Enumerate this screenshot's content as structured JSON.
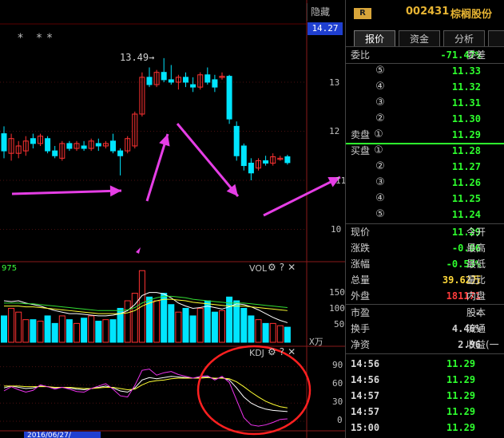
{
  "window": {
    "hide_label": "隐藏>>"
  },
  "kline": {
    "current_price_tag": "14.27",
    "stars": "* **",
    "peak_label": "13.49→",
    "y_ticks": [
      "13",
      "12",
      "11",
      "10"
    ],
    "up_color": "#ff3232",
    "down_color": "#00e5ff",
    "candles": [
      {
        "o": 11.95,
        "h": 12.1,
        "l": 11.45,
        "c": 11.6
      },
      {
        "o": 11.55,
        "h": 11.95,
        "l": 11.4,
        "c": 11.85
      },
      {
        "o": 11.55,
        "h": 11.8,
        "l": 11.45,
        "c": 11.7
      },
      {
        "o": 11.6,
        "h": 11.9,
        "l": 11.5,
        "c": 11.8
      },
      {
        "o": 11.85,
        "h": 11.95,
        "l": 11.65,
        "c": 11.75
      },
      {
        "o": 11.75,
        "h": 11.95,
        "l": 11.7,
        "c": 11.9
      },
      {
        "o": 11.85,
        "h": 11.9,
        "l": 11.55,
        "c": 11.6
      },
      {
        "o": 11.6,
        "h": 11.7,
        "l": 11.45,
        "c": 11.5
      },
      {
        "o": 11.45,
        "h": 11.8,
        "l": 11.4,
        "c": 11.75
      },
      {
        "o": 11.75,
        "h": 11.8,
        "l": 11.6,
        "c": 11.65
      },
      {
        "o": 11.65,
        "h": 11.8,
        "l": 11.6,
        "c": 11.75
      },
      {
        "o": 11.7,
        "h": 11.8,
        "l": 11.6,
        "c": 11.65
      },
      {
        "o": 11.65,
        "h": 11.85,
        "l": 11.6,
        "c": 11.8
      },
      {
        "o": 11.75,
        "h": 11.85,
        "l": 11.6,
        "c": 11.7
      },
      {
        "o": 11.7,
        "h": 11.8,
        "l": 11.65,
        "c": 11.75
      },
      {
        "o": 11.8,
        "h": 11.95,
        "l": 11.55,
        "c": 11.6
      },
      {
        "o": 11.6,
        "h": 11.65,
        "l": 11.1,
        "c": 11.5
      },
      {
        "o": 11.6,
        "h": 11.9,
        "l": 11.55,
        "c": 11.85
      },
      {
        "o": 11.7,
        "h": 12.4,
        "l": 11.65,
        "c": 12.35
      },
      {
        "o": 12.35,
        "h": 13.2,
        "l": 12.3,
        "c": 13.1
      },
      {
        "o": 13.1,
        "h": 13.3,
        "l": 12.9,
        "c": 12.95
      },
      {
        "o": 12.95,
        "h": 13.25,
        "l": 12.9,
        "c": 13.2
      },
      {
        "o": 13.2,
        "h": 13.49,
        "l": 13.0,
        "c": 13.05
      },
      {
        "o": 13.05,
        "h": 13.35,
        "l": 12.95,
        "c": 13.0
      },
      {
        "o": 13.0,
        "h": 13.15,
        "l": 12.85,
        "c": 13.1
      },
      {
        "o": 13.1,
        "h": 13.2,
        "l": 12.9,
        "c": 13.0
      },
      {
        "o": 12.95,
        "h": 13.1,
        "l": 12.8,
        "c": 12.9
      },
      {
        "o": 12.9,
        "h": 13.2,
        "l": 12.85,
        "c": 13.15
      },
      {
        "o": 13.15,
        "h": 13.3,
        "l": 12.95,
        "c": 13.0
      },
      {
        "o": 13.05,
        "h": 13.15,
        "l": 12.8,
        "c": 12.9
      },
      {
        "o": 13.1,
        "h": 13.2,
        "l": 13.05,
        "c": 13.12
      },
      {
        "o": 13.12,
        "h": 13.15,
        "l": 12.15,
        "c": 12.25
      },
      {
        "o": 12.1,
        "h": 12.2,
        "l": 11.4,
        "c": 11.5
      },
      {
        "o": 11.7,
        "h": 11.75,
        "l": 11.2,
        "c": 11.3
      },
      {
        "o": 11.35,
        "h": 11.45,
        "l": 11.0,
        "c": 11.15
      },
      {
        "o": 11.25,
        "h": 11.45,
        "l": 11.2,
        "c": 11.4
      },
      {
        "o": 11.4,
        "h": 11.5,
        "l": 11.3,
        "c": 11.35
      },
      {
        "o": 11.35,
        "h": 11.55,
        "l": 11.3,
        "c": 11.48
      },
      {
        "o": 11.45,
        "h": 11.5,
        "l": 11.4,
        "c": 11.45
      },
      {
        "o": 11.48,
        "h": 11.52,
        "l": 11.32,
        "c": 11.36
      }
    ]
  },
  "volume": {
    "title": "VOL",
    "indicator_value": "975",
    "y_ticks": [
      "150",
      "100",
      "50"
    ],
    "unit": "X万",
    "bars": [
      35,
      45,
      40,
      30,
      30,
      28,
      35,
      25,
      35,
      30,
      25,
      32,
      35,
      28,
      30,
      30,
      45,
      55,
      65,
      95,
      60,
      55,
      65,
      50,
      40,
      45,
      35,
      45,
      55,
      40,
      42,
      60,
      55,
      45,
      35,
      30,
      25,
      25,
      22,
      20
    ],
    "ma5": [
      55,
      54,
      55,
      52,
      50,
      48,
      45,
      42,
      40,
      38,
      38,
      37,
      36,
      35,
      35,
      36,
      38,
      42,
      50,
      62,
      66,
      66,
      64,
      59,
      52,
      48,
      45,
      46,
      48,
      46,
      44,
      47,
      51,
      50,
      47,
      43,
      38,
      33,
      29,
      26
    ],
    "ma10": [
      48,
      48,
      48,
      47,
      47,
      46,
      45,
      44,
      43,
      42,
      41,
      40,
      39,
      38,
      38,
      38,
      38,
      39,
      42,
      48,
      52,
      55,
      57,
      57,
      56,
      55,
      53,
      52,
      51,
      50,
      49,
      48,
      48,
      48,
      47,
      46,
      45,
      44,
      43,
      42
    ]
  },
  "kdj": {
    "title": "KDJ",
    "y_ticks": [
      "90",
      "60",
      "30",
      "0"
    ],
    "k": [
      55,
      58,
      56,
      54,
      55,
      58,
      57,
      55,
      56,
      55,
      53,
      52,
      54,
      56,
      58,
      55,
      50,
      48,
      55,
      68,
      72,
      70,
      72,
      74,
      73,
      72,
      71,
      72,
      73,
      70,
      72,
      68,
      55,
      40,
      30,
      24,
      20,
      18,
      17,
      16
    ],
    "d": [
      58,
      58,
      58,
      57,
      57,
      57,
      57,
      56,
      56,
      56,
      55,
      54,
      54,
      55,
      56,
      56,
      54,
      52,
      53,
      60,
      65,
      67,
      68,
      70,
      71,
      71,
      71,
      71,
      72,
      71,
      71,
      70,
      65,
      57,
      48,
      40,
      33,
      28,
      24,
      22
    ],
    "j": [
      50,
      57,
      52,
      48,
      51,
      60,
      57,
      53,
      56,
      53,
      49,
      48,
      54,
      58,
      62,
      53,
      42,
      40,
      59,
      84,
      86,
      76,
      80,
      82,
      77,
      74,
      71,
      74,
      75,
      68,
      74,
      64,
      35,
      6,
      -6,
      -8,
      -6,
      -2,
      3,
      4
    ]
  },
  "date_label": "2016/06/27/",
  "stock": {
    "badge": "R",
    "code": "002431",
    "name": "棕榈股份"
  },
  "tabs": [
    "报价",
    "资金",
    "分析"
  ],
  "order_book": {
    "ratio_label": "委比",
    "ratio_value": "-71.47%",
    "diff_label": "委差",
    "sell_label": "卖盘",
    "buy_label": "买盘",
    "sells": [
      {
        "level": "⑤",
        "price": "11.33"
      },
      {
        "level": "④",
        "price": "11.32"
      },
      {
        "level": "③",
        "price": "11.31"
      },
      {
        "level": "②",
        "price": "11.30"
      },
      {
        "level": "①",
        "price": "11.29"
      }
    ],
    "buys": [
      {
        "level": "①",
        "price": "11.28"
      },
      {
        "level": "②",
        "price": "11.27"
      },
      {
        "level": "③",
        "price": "11.26"
      },
      {
        "level": "④",
        "price": "11.25"
      },
      {
        "level": "⑤",
        "price": "11.24"
      }
    ]
  },
  "stats": [
    {
      "l": "现价",
      "v": "11.29",
      "c": "green",
      "r": "今开"
    },
    {
      "l": "涨跌",
      "v": "-0.06",
      "c": "green",
      "r": "最高"
    },
    {
      "l": "涨幅",
      "v": "-0.53%",
      "c": "green",
      "r": "最低"
    },
    {
      "l": "总量",
      "v": "39.62万",
      "c": "yellow",
      "r": "量比"
    },
    {
      "l": "外盘",
      "v": "181171",
      "c": "red",
      "r": "内盘"
    }
  ],
  "stats2": [
    {
      "l": "市盈",
      "v": "-",
      "c": "white",
      "r": "股本"
    },
    {
      "l": "换手",
      "v": "4.46%",
      "c": "white",
      "r": "流通"
    },
    {
      "l": "净资",
      "v": "2.96",
      "c": "white",
      "r": "收益(一"
    }
  ],
  "ticks": [
    {
      "t": "14:56",
      "p": "11.29"
    },
    {
      "t": "14:56",
      "p": "11.29"
    },
    {
      "t": "14:57",
      "p": "11.29"
    },
    {
      "t": "14:57",
      "p": "11.29"
    },
    {
      "t": "15:00",
      "p": "11.29"
    }
  ]
}
